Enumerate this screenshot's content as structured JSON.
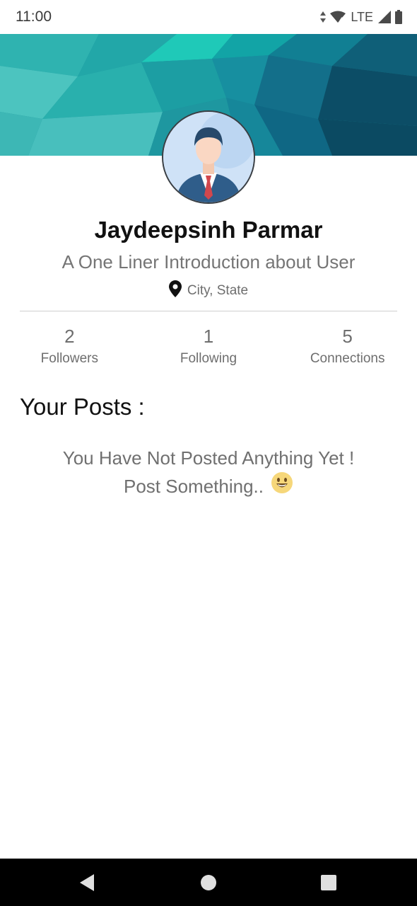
{
  "status_bar": {
    "time": "11:00",
    "network": "LTE",
    "icons": [
      "data-arrows-icon",
      "wifi-icon",
      "signal-icon",
      "battery-icon"
    ]
  },
  "profile": {
    "name": "Jaydeepsinh Parmar",
    "bio": "A One Liner Introduction about User",
    "location": "City, State",
    "avatar_icon": "businessman-avatar-icon"
  },
  "stats": [
    {
      "value": "2",
      "label": "Followers"
    },
    {
      "value": "1",
      "label": "Following"
    },
    {
      "value": "5",
      "label": "Connections"
    }
  ],
  "posts": {
    "title": "Your Posts :",
    "empty_line1": "You Have Not Posted Anything Yet !",
    "empty_line2": "Post Something..",
    "emoji_icon": "smiley-emoji-icon"
  },
  "nav_bar": {
    "buttons": [
      "back-icon",
      "home-icon",
      "recents-icon"
    ]
  },
  "colors": {
    "cover_primary": "#1aa3a3",
    "cover_dark": "#0e4f66",
    "text_secondary": "#757575",
    "nav_background": "#000000"
  }
}
